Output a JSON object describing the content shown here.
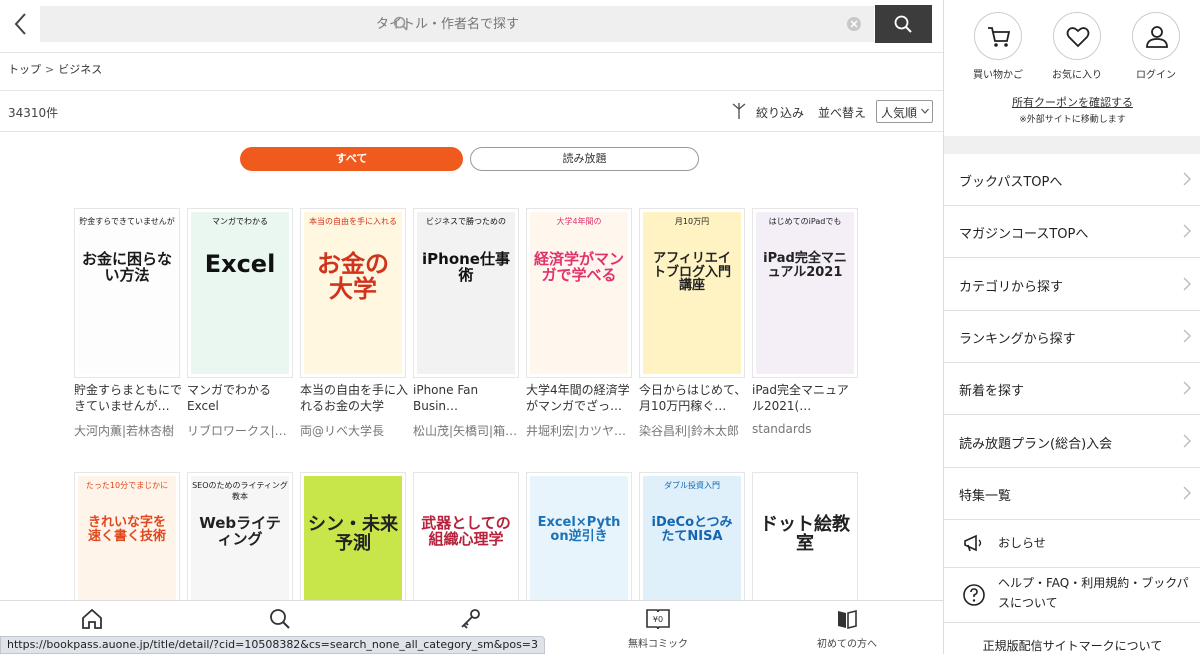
{
  "search": {
    "placeholder": "タイトル・作者名で探す"
  },
  "breadcrumb": {
    "items": [
      "トップ",
      "ビジネス"
    ],
    "separator": ">"
  },
  "results": {
    "count": "34310件"
  },
  "filter": {
    "filter_label": "絞り込み",
    "sort_label": "並べ替え",
    "sort_value": "人気順"
  },
  "tabs": {
    "all": "すべて",
    "unlimited": "読み放題"
  },
  "colors": {
    "accent": "#f15a1d",
    "search_button": "#3c3c3c"
  },
  "books_row1": [
    {
      "title": "貯金すらまともにできていませんが…",
      "author": "大河内薫|若林杏樹",
      "cover_main": "お金に困らない方法",
      "cover_sub": "貯金すらできていませんが",
      "bg": "#fdfdfd",
      "fg": "#1a1a1a"
    },
    {
      "title": "マンガでわかるExcel",
      "author": "リブロワークス|…",
      "cover_main": "Excel",
      "cover_sub": "マンガでわかる",
      "bg": "#eaf6f0",
      "fg": "#111"
    },
    {
      "title": "本当の自由を手に入れるお金の大学",
      "author": "両@リベ大学長",
      "cover_main": "お金の大学",
      "cover_sub": "本当の自由を手に入れる",
      "bg": "#fff7e0",
      "fg": "#d0341c"
    },
    {
      "title": "iPhone Fan Busin…",
      "author": "松山茂|矢橋司|箱…",
      "cover_main": "iPhone仕事術",
      "cover_sub": "ビジネスで勝つための",
      "bg": "#f2f2f2",
      "fg": "#111"
    },
    {
      "title": "大学4年間の経済学がマンガでざっ…",
      "author": "井堀利宏|カツヤ…",
      "cover_main": "経済学がマンガで学べる",
      "cover_sub": "大学4年間の",
      "bg": "#fff6ee",
      "fg": "#e0336c"
    },
    {
      "title": "今日からはじめて、月10万円稼ぐ…",
      "author": "染谷昌利|鈴木太郎",
      "cover_main": "アフィリエイトブログ入門講座",
      "cover_sub": "月10万円",
      "bg": "#fff3c4",
      "fg": "#222"
    },
    {
      "title": "iPad完全マニュアル2021(…",
      "author": "standards",
      "cover_main": "iPad完全マニュアル2021",
      "cover_sub": "はじめてのiPadでも",
      "bg": "#f4eef6",
      "fg": "#222"
    }
  ],
  "books_row2": [
    {
      "cover_main": "きれいな字を速く書く技術",
      "cover_sub": "たった10分でまじかに",
      "bg": "#fff4ea",
      "fg": "#e1481e"
    },
    {
      "cover_main": "Webライティング",
      "cover_sub": "SEOのためのライティング教本",
      "bg": "#f6f6f6",
      "fg": "#222"
    },
    {
      "cover_main": "シン・未来予測",
      "cover_sub": "",
      "bg": "#c8e64a",
      "fg": "#222"
    },
    {
      "cover_main": "武器としての組織心理学",
      "cover_sub": "",
      "bg": "#fff",
      "fg": "#b8213b"
    },
    {
      "cover_main": "Excel×Python逆引き",
      "cover_sub": "",
      "bg": "#e8f4fb",
      "fg": "#1a73b8"
    },
    {
      "cover_main": "iDeCoとつみたてNISA",
      "cover_sub": "ダブル投資入門",
      "bg": "#dff0fb",
      "fg": "#1466b0"
    },
    {
      "cover_main": "ドット絵教室",
      "cover_sub": "",
      "bg": "#fff",
      "fg": "#222"
    }
  ],
  "bottom_nav": [
    {
      "label": "",
      "icon": "home-icon"
    },
    {
      "label": "",
      "icon": "search-icon"
    },
    {
      "label": "",
      "icon": "key-icon"
    },
    {
      "label": "無料コミック",
      "icon": "free-comic-icon"
    },
    {
      "label": "初めての方へ",
      "icon": "book-icon"
    }
  ],
  "status_url": "https://bookpass.auone.jp/title/detail/?cid=10508382&cs=search_none_all_category_sm&pos=3",
  "sidebar": {
    "cart_label": "買い物かご",
    "favorite_label": "お気に入り",
    "login_label": "ログイン",
    "coupon_link": "所有クーポンを確認する",
    "coupon_note": "※外部サイトに移動します",
    "menu": [
      "ブックパスTOPへ",
      "マガジンコースTOPへ",
      "カテゴリから探す",
      "ランキングから探す",
      "新着を探す",
      "読み放題プラン(総合)入会",
      "特集一覧"
    ],
    "news_label": "おしらせ",
    "help_label": "ヘルプ・FAQ・利用規約・ブックパスについて",
    "official_label": "正規版配信サイトマークについて"
  }
}
